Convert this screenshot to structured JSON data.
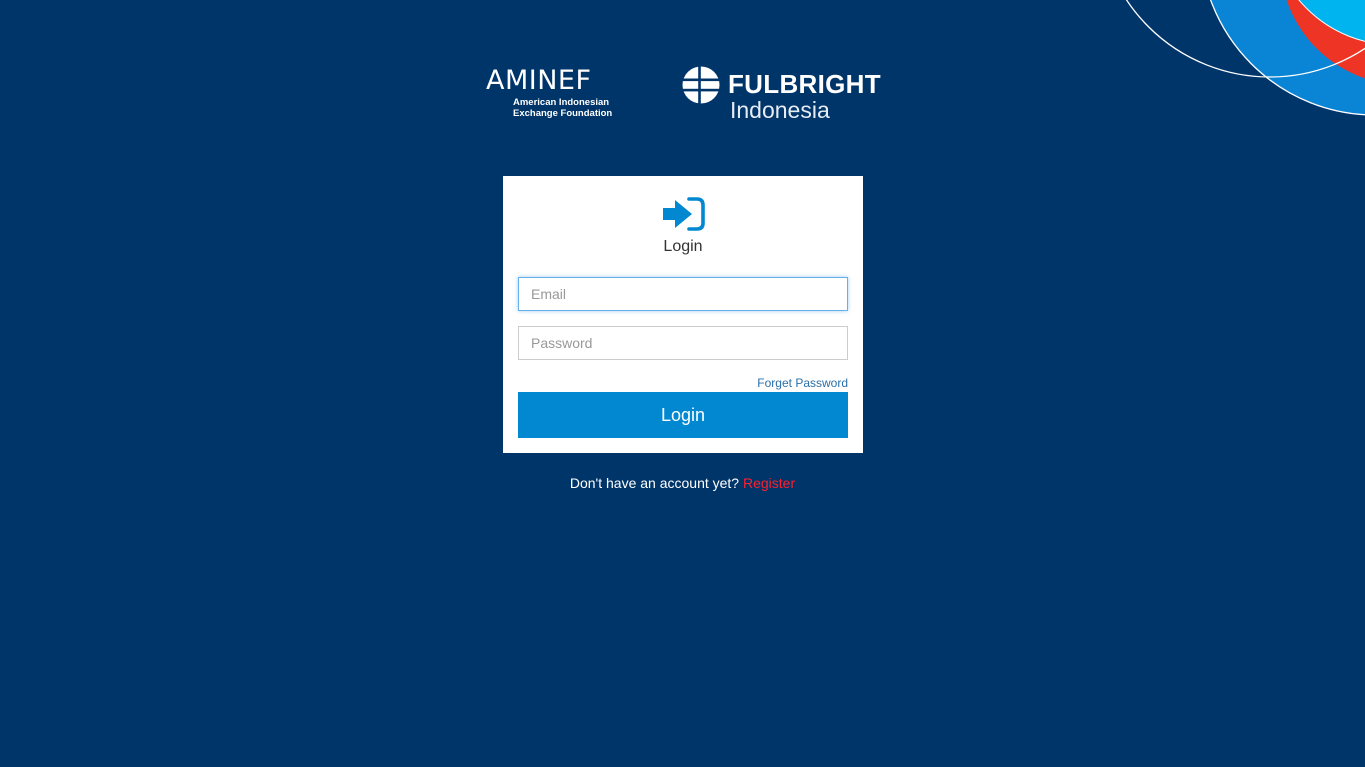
{
  "brand": {
    "aminef": {
      "name": "AMINEF",
      "subtitle_line1": "American Indonesian",
      "subtitle_line2": "Exchange Foundation"
    },
    "fulbright": {
      "name": "FULBRIGHT",
      "subtitle": "Indonesia"
    }
  },
  "login_form": {
    "title": "Login",
    "email_placeholder": "Email",
    "email_value": "",
    "password_placeholder": "Password",
    "password_value": "",
    "forget_password_label": "Forget Password",
    "submit_label": "Login"
  },
  "register_prompt": {
    "text": "Don't have an account yet?",
    "link_label": "Register"
  },
  "icons": {
    "login": "sign-in-icon",
    "globe": "fulbright-globe-icon"
  },
  "colors": {
    "background": "#00356a",
    "accent": "#0288d1",
    "register_link": "#ff1f2e",
    "deco_light_blue": "#00aeef",
    "deco_mid_blue": "#0a7fd0",
    "deco_red": "#ee3424"
  }
}
